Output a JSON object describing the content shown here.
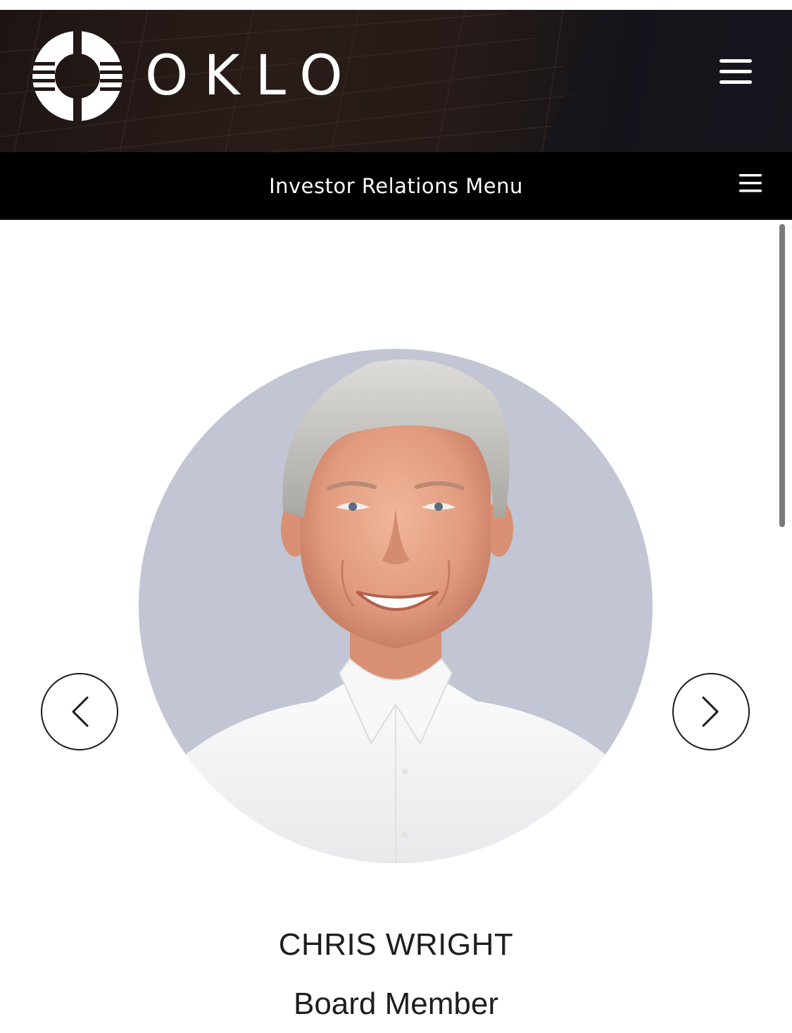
{
  "header": {
    "logo_text": "OKLO",
    "logo_icon": "oklo-ring-logo",
    "menu_icon": "hamburger-menu-icon"
  },
  "investor_relations": {
    "label": "Investor Relations Menu",
    "menu_icon": "hamburger-menu-icon"
  },
  "carousel": {
    "prev_icon": "chevron-left-icon",
    "next_icon": "chevron-right-icon",
    "portrait_background": "#c2c5d3"
  },
  "person": {
    "name": "CHRIS WRIGHT",
    "role": "Board Member"
  },
  "colors": {
    "header_dark": "#1d1513",
    "nav_bar": "#000000",
    "text": "#1e1e1e"
  }
}
